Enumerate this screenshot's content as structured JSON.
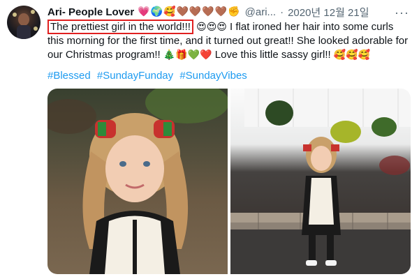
{
  "user": {
    "name": "Ari- People Lover",
    "emojis": "💗🌍🥰🤎🤎🤎🤎✊",
    "handle": "@ari...",
    "separator": "·",
    "date": "2020년 12월 21일",
    "more": "···"
  },
  "tweet": {
    "highlight": "The prettiest girl in the world!!!",
    "highlight_emojis": "😍😍😍",
    "body": " I flat ironed her hair into some curls this morning for the first time, and it turned out great!! She looked adorable for our Christmas program!! ",
    "body_emojis": "🎄🎁💚❤️",
    "body2": " Love this little sassy girl!! ",
    "end_emojis": "🥰🥰🥰"
  },
  "hashtags": [
    "#Blessed",
    "#SundayFunday",
    "#SundayVibes"
  ],
  "colors": {
    "link": "#1d9bf0",
    "highlight_box": "#e02020",
    "muted": "#536471"
  },
  "icons": {
    "avatar": "avatar",
    "more": "more-options-icon"
  }
}
